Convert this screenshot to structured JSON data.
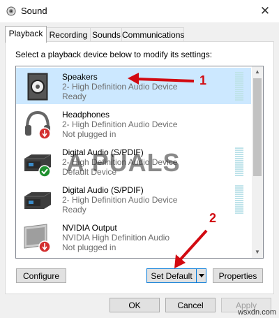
{
  "window": {
    "title": "Sound",
    "close_glyph": "✕"
  },
  "tabs": [
    {
      "label": "Playback",
      "active": true
    },
    {
      "label": "Recording",
      "active": false
    },
    {
      "label": "Sounds",
      "active": false
    },
    {
      "label": "Communications",
      "active": false
    }
  ],
  "instruction": "Select a playback device below to modify its settings:",
  "devices": [
    {
      "name": "Speakers",
      "description": "2- High Definition Audio Device",
      "status": "Ready",
      "icon": "speaker-icon",
      "selected": true
    },
    {
      "name": "Headphones",
      "description": "2- High Definition Audio Device",
      "status": "Not plugged in",
      "icon": "headphones-icon",
      "selected": false
    },
    {
      "name": "Digital Audio (S/PDIF)",
      "description": "2- High Definition Audio Device",
      "status": "Default Device",
      "icon": "digital-audio-icon",
      "selected": false
    },
    {
      "name": "Digital Audio (S/PDIF)",
      "description": "2- High Definition Audio Device",
      "status": "Ready",
      "icon": "digital-audio-icon",
      "selected": false
    },
    {
      "name": "NVIDIA Output",
      "description": "NVIDIA High Definition Audio",
      "status": "Not plugged in",
      "icon": "monitor-icon",
      "selected": false
    }
  ],
  "buttons": {
    "configure": "Configure",
    "set_default": "Set Default",
    "properties": "Properties",
    "ok": "OK",
    "cancel": "Cancel",
    "apply": "Apply"
  },
  "annotations": {
    "one": "1",
    "two": "2"
  },
  "watermark": "A  PUALS",
  "site_watermark": "wsxdn.com",
  "colors": {
    "selection": "#cce8ff",
    "annotation": "#d20a11",
    "focus_border": "#0078d7"
  }
}
